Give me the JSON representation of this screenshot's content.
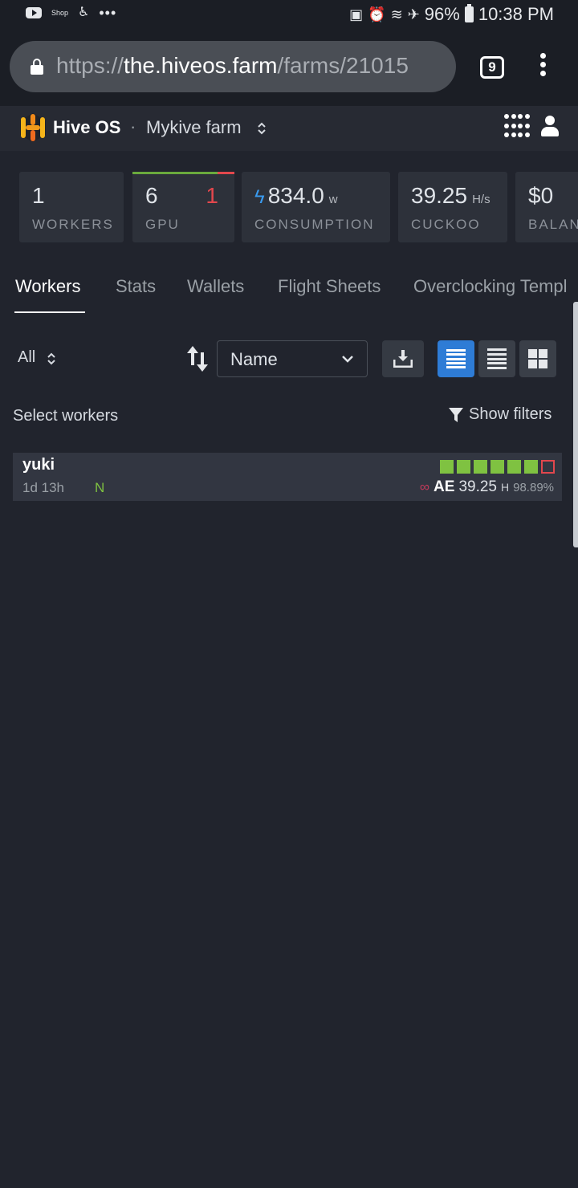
{
  "statusbar": {
    "left_icons": [
      "youtube-icon",
      "shop-icon",
      "figure-icon",
      "more-dots"
    ],
    "shop_label": "Shop",
    "dots": "•••",
    "battery": "96%",
    "time": "10:38 PM"
  },
  "browser": {
    "url_scheme": "https://",
    "url_host": "the.hiveos.farm",
    "url_path": "/farms/21015",
    "tab_count": "9"
  },
  "header": {
    "brand": "Hive OS",
    "separator": "·",
    "farm_name": "Mykive farm"
  },
  "stats": {
    "workers": {
      "value": "1",
      "label": "WORKERS"
    },
    "gpu": {
      "value": "6",
      "offline": "1",
      "label": "GPU",
      "online_fraction": 0.83
    },
    "consumption": {
      "value": "834.0",
      "unit": "w",
      "label": "CONSUMPTION"
    },
    "hashrate": {
      "value": "39.25",
      "unit": "H/s",
      "label": "CUCKOO"
    },
    "balance": {
      "value": "$0",
      "label": "BALAN"
    }
  },
  "tabs": [
    "Workers",
    "Stats",
    "Wallets",
    "Flight Sheets",
    "Overclocking Templ"
  ],
  "toolbar": {
    "filter": "All",
    "sort_select": "Name",
    "select_workers": "Select workers",
    "show_filters": "Show filters"
  },
  "workers": [
    {
      "name": "yuki",
      "uptime": "1d 13h",
      "tag": "N",
      "gpu_states": [
        "ok",
        "ok",
        "ok",
        "ok",
        "ok",
        "ok",
        "off"
      ],
      "algo": "AE",
      "hashrate": "39.25",
      "hash_unit": "H",
      "share_pct": "98.89%"
    }
  ],
  "colors": {
    "background": "#21242d",
    "card": "#2d313a",
    "accent_blue": "#2e7cd6",
    "ok_green": "#7fc241",
    "error_red": "#e2474d"
  }
}
